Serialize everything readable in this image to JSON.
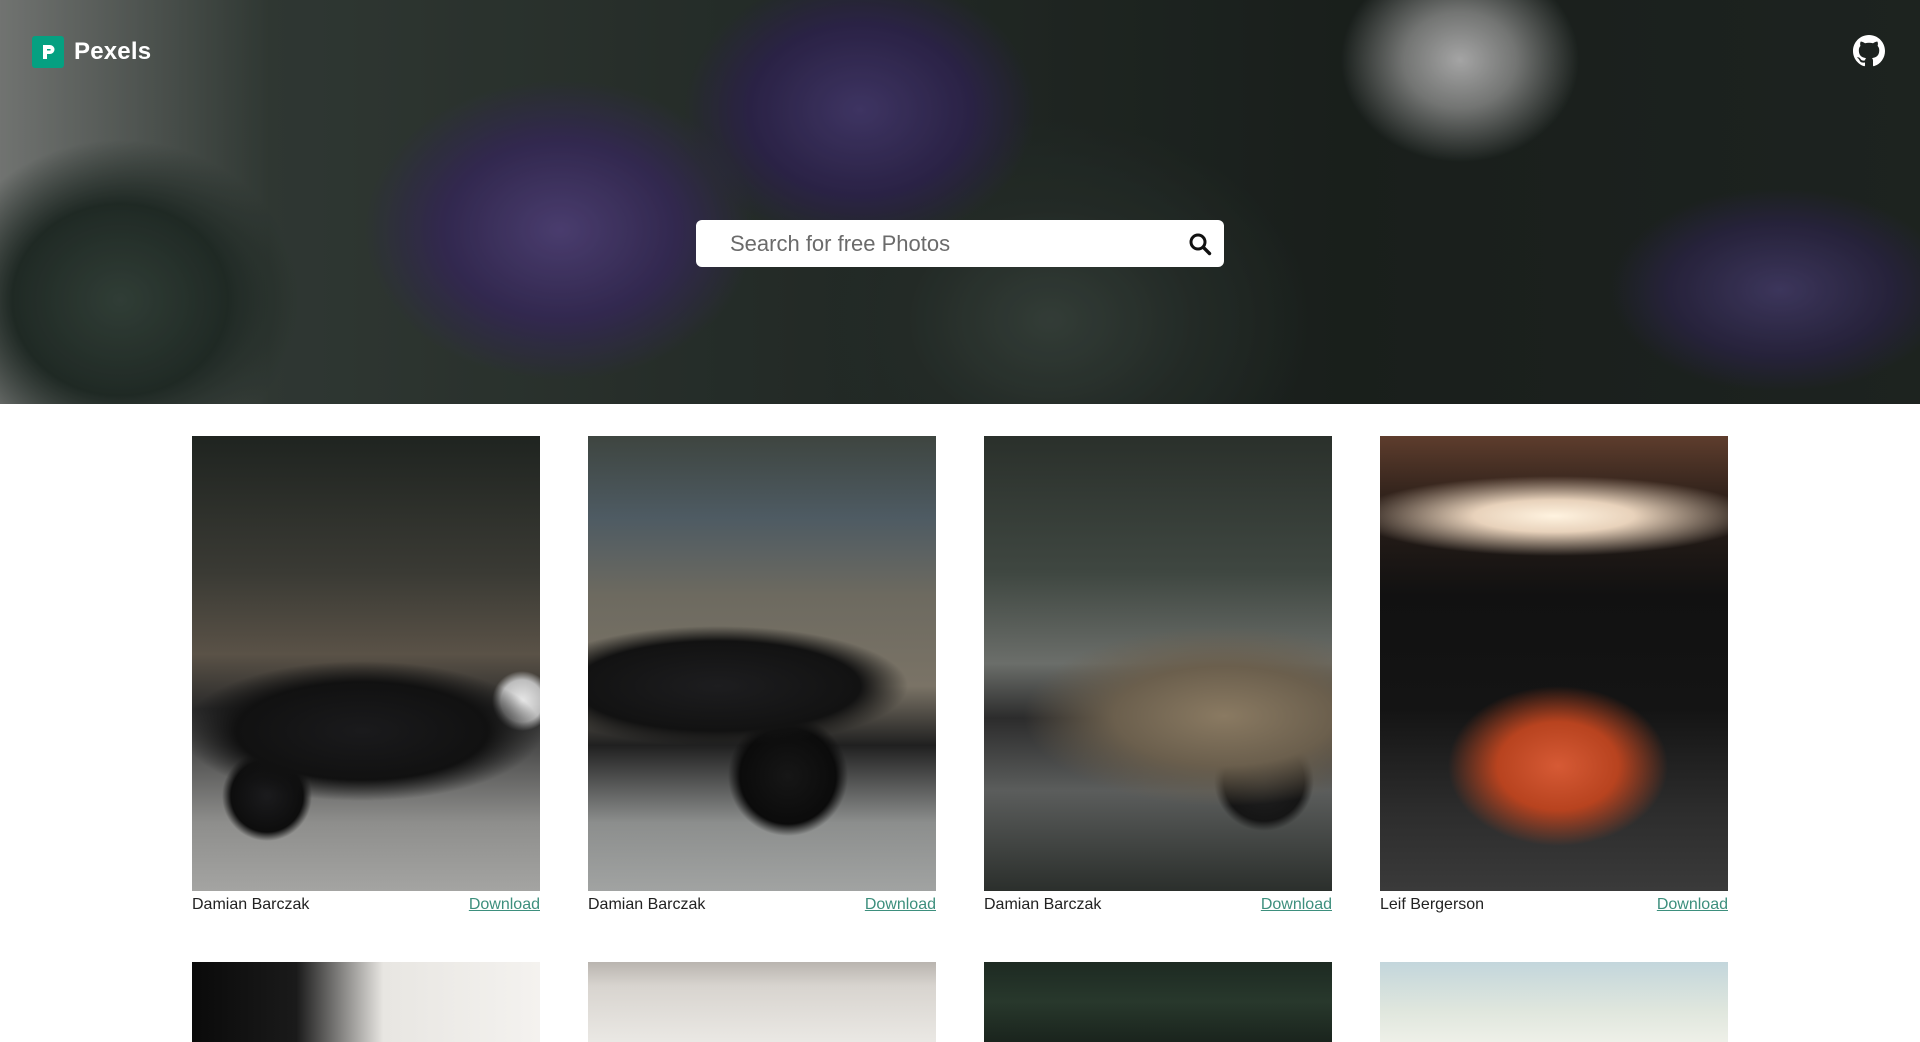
{
  "header": {
    "brand_name": "Pexels",
    "brand_icon": "pexels-logo-icon",
    "github_icon": "github-icon",
    "accent_color": "#05a081"
  },
  "search": {
    "placeholder": "Search for free Photos",
    "value": "",
    "icon": "search-icon"
  },
  "photos": [
    {
      "author": "Damian Barczak",
      "download_label": "Download"
    },
    {
      "author": "Damian Barczak",
      "download_label": "Download"
    },
    {
      "author": "Damian Barczak",
      "download_label": "Download"
    },
    {
      "author": "Leif Bergerson",
      "download_label": "Download"
    }
  ],
  "link_color": "#3d8f7d"
}
